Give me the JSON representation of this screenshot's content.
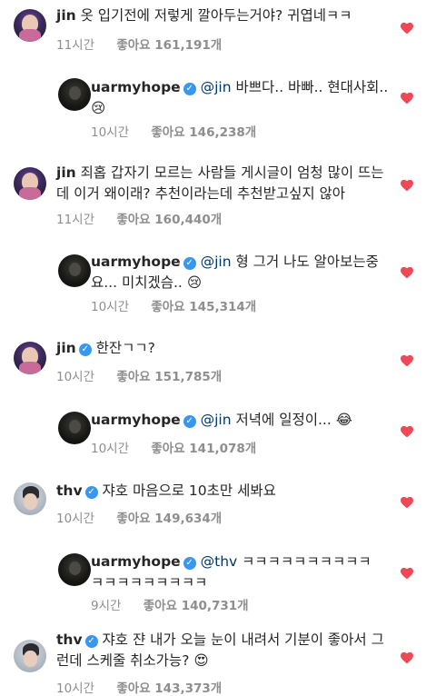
{
  "colors": {
    "heart": "#ed4956",
    "verified": "#3897f0",
    "mention": "#00376b",
    "meta": "#8e8e8e"
  },
  "comments": [
    {
      "user": "jin",
      "verified": false,
      "mention": "",
      "text": "옷 입기전에 저렇게 깔아두는거야? 귀엽네ㅋㅋ",
      "time": "11시간",
      "likes": "좋아요 161,191개",
      "reply": false,
      "avatar": "jin-avatar"
    },
    {
      "user": "uarmyhope",
      "verified": true,
      "mention": "@jin",
      "text": "바쁘다.. 바빠.. 현대사회..",
      "emoji": "😢",
      "time": "10시간",
      "likes": "좋아요 146,238개",
      "reply": true,
      "avatar": "uarmyhope-avatar"
    },
    {
      "user": "jin",
      "verified": false,
      "mention": "",
      "text": "죄홉 갑자기 모르는 사람들 게시글이 엄청 많이 뜨는데 이거 왜이래? 추천이라는데 추천받고싶지 않아",
      "time": "11시간",
      "likes": "좋아요 160,440개",
      "reply": false,
      "avatar": "jin-avatar"
    },
    {
      "user": "uarmyhope",
      "verified": true,
      "mention": "@jin",
      "text": "형 그거 나도 알아보는중요... 미치겠슴..",
      "emoji": "😢",
      "time": "10시간",
      "likes": "좋아요 145,314개",
      "reply": true,
      "avatar": "uarmyhope-avatar"
    },
    {
      "user": "jin",
      "verified": true,
      "mention": "",
      "text": "한잔ㄱㄱ?",
      "time": "10시간",
      "likes": "좋아요 151,785개",
      "reply": false,
      "avatar": "jin-avatar"
    },
    {
      "user": "uarmyhope",
      "verified": true,
      "mention": "@jin",
      "text": "저녁에 일정이...",
      "emoji": "😂",
      "time": "10시간",
      "likes": "좋아요 141,078개",
      "reply": true,
      "avatar": "uarmyhope-avatar"
    },
    {
      "user": "thv",
      "verified": true,
      "mention": "",
      "text": "쟈호 마음으로 10초만 세봐요",
      "time": "10시간",
      "likes": "좋아요 149,634개",
      "reply": false,
      "avatar": "thv-avatar"
    },
    {
      "user": "uarmyhope",
      "verified": true,
      "mention": "@thv",
      "text": "ㅋㅋㅋㅋㅋㅋㅋㅋㅋㅋㅋㅋㅋㅋㅋㅋㅋㅋㅋ",
      "time": "9시간",
      "likes": "좋아요 140,731개",
      "reply": true,
      "avatar": "uarmyhope-avatar"
    },
    {
      "user": "thv",
      "verified": true,
      "mention": "",
      "text": "쟈호 쟌 내가 오늘 눈이 내려서 기분이 좋아서 그런데 스케줄 취소가능?",
      "emoji": "😍",
      "time": "10시간",
      "likes": "좋아요 143,373개",
      "reply": false,
      "avatar": "thv-avatar"
    }
  ]
}
